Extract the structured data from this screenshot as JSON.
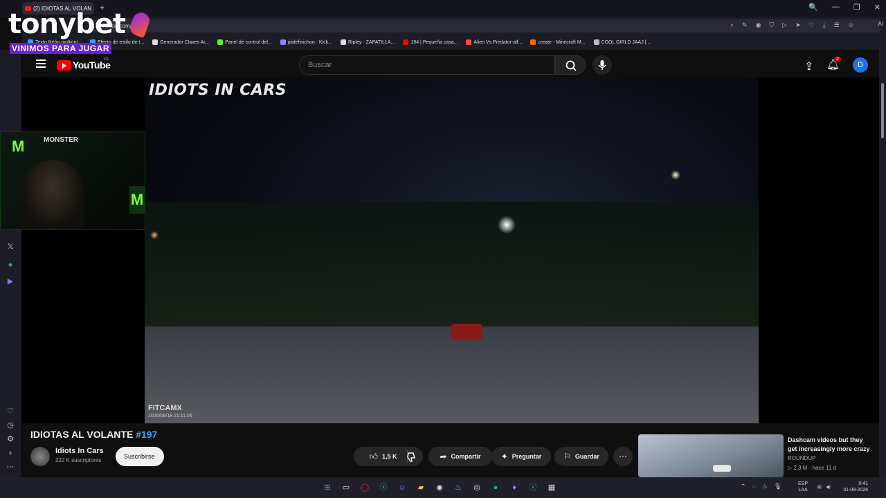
{
  "browser": {
    "tab_title": "(2) IDIOTAS AL VOLAN",
    "new_tab": "+",
    "url_partial": "youtube.com/",
    "ai_label": "AI",
    "window_controls": [
      "🔍",
      "—",
      "❐",
      "✕"
    ],
    "bookmarks": [
      {
        "label": "Texto Neón multicol...",
        "color": "#3aa0ff"
      },
      {
        "label": "Efecto de estilo de t...",
        "color": "#3aa0ff"
      },
      {
        "label": "Generador Claves Ar...",
        "color": "#dddddd"
      },
      {
        "label": "Panel de control del...",
        "color": "#53fc18"
      },
      {
        "label": "jaidefinichon - Kick...",
        "color": "#8888ff"
      },
      {
        "label": "Ripley - ZAPATILLA...",
        "color": "#dddddd"
      },
      {
        "label": "194 | Pequeña casa...",
        "color": "#ff0000"
      },
      {
        "label": "Alien Vs Predator-alf...",
        "color": "#ff4444"
      },
      {
        "label": "create - Minecraft M...",
        "color": "#ff6600"
      },
      {
        "label": "COOL GIRLD JAAJ |...",
        "color": "#bbbbbb"
      }
    ]
  },
  "overlay": {
    "brand": "tonybet",
    "tagline": "VINIMOS PARA JUGAR",
    "webcam_brand": "MONSTER"
  },
  "youtube": {
    "logo_text": "YouTube",
    "country_code": "CL",
    "search_placeholder": "Buscar",
    "notification_count": "2",
    "avatar_letter": "D",
    "accent_color": "#ff0000"
  },
  "video": {
    "overlay_title": "IDIOTS IN CARS",
    "dashcam_brand": "FITCAMX",
    "dashcam_timestamp": "2026/08/18  21:11:06",
    "title": "IDIOTAS AL VOLANTE",
    "title_tag": "#197",
    "channel_name": "Idiots In Cars",
    "channel_subs": "222 K suscriptores",
    "subscribe_label": "Suscribirse",
    "likes": "1,5 K",
    "share_label": "Compartir",
    "ask_label": "Preguntar",
    "save_label": "Guardar"
  },
  "recommended": {
    "title": "Dashcam videos but they get increasingly more crazy",
    "channel": "ROUNDUP",
    "views": "2,3 M",
    "age": "hace 11 d"
  },
  "taskbar": {
    "lang_top": "ESP",
    "lang_bottom": "LAA",
    "time": "0:41",
    "date": "31-08-2026"
  }
}
